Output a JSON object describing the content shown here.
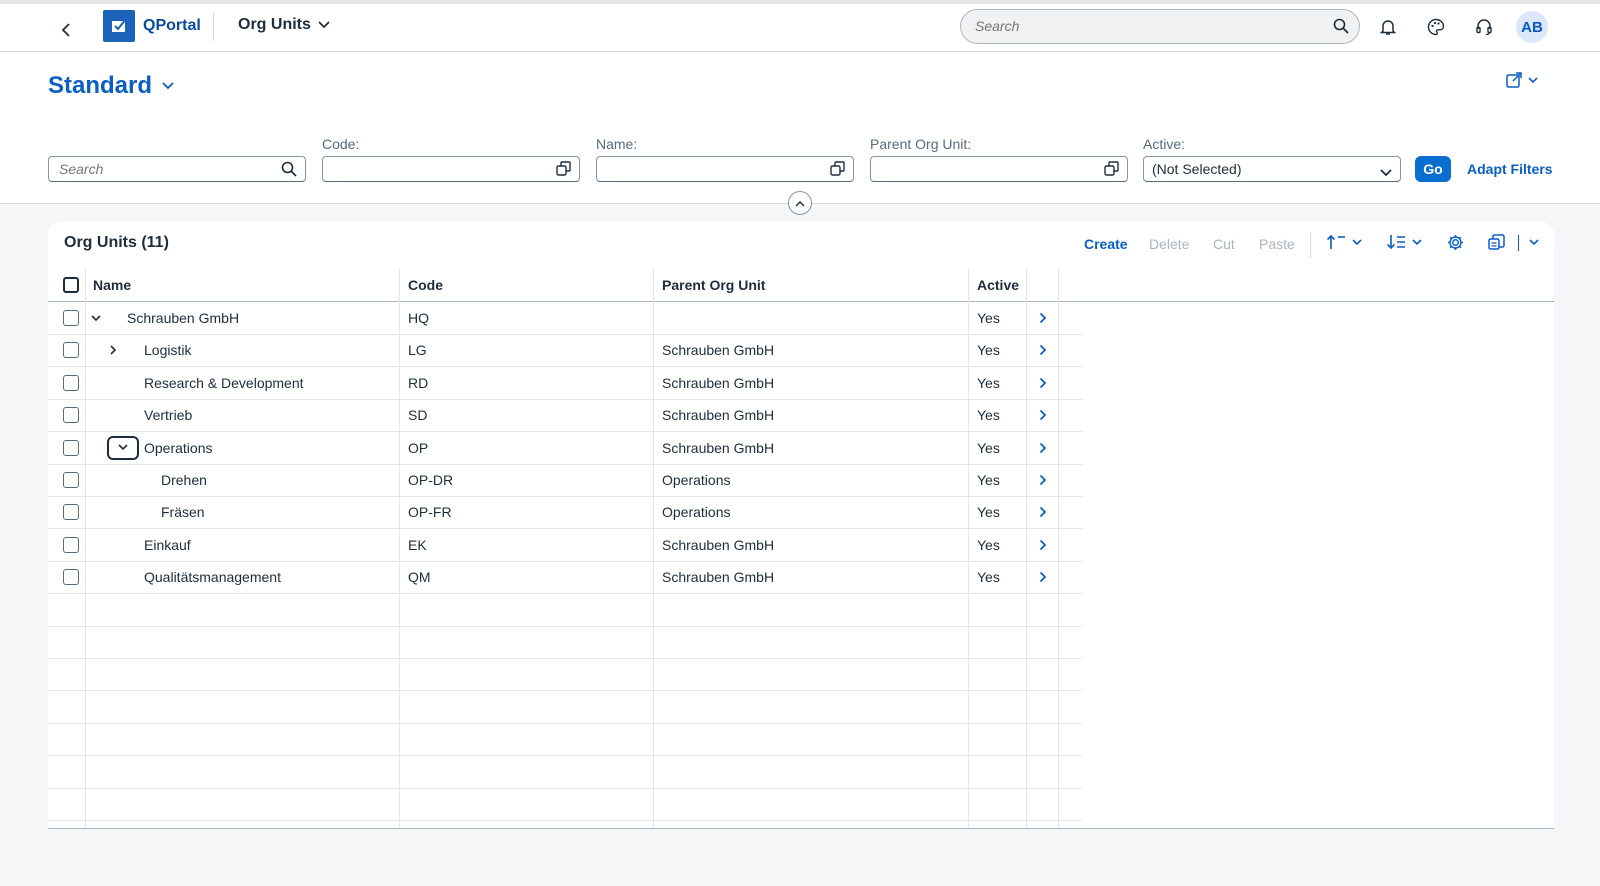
{
  "shell": {
    "brand": "QPortal",
    "app_title": "Org Units",
    "search_placeholder": "Search",
    "avatar_initials": "AB",
    "icons": [
      "back-icon",
      "notification-icon",
      "palette-icon",
      "headset-icon"
    ]
  },
  "header": {
    "variant_title": "Standard",
    "filters": {
      "search_placeholder": "Search",
      "code_label": "Code:",
      "name_label": "Name:",
      "parent_label": "Parent Org Unit:",
      "active_label": "Active:",
      "active_value": "(Not Selected)"
    },
    "go_label": "Go",
    "adapt_label": "Adapt Filters"
  },
  "table": {
    "title": "Org Units (11)",
    "toolbar": {
      "create": "Create",
      "delete": "Delete",
      "cut": "Cut",
      "paste": "Paste"
    },
    "columns": {
      "name": "Name",
      "code": "Code",
      "parent": "Parent Org Unit",
      "active": "Active"
    },
    "rows": [
      {
        "name": "Schrauben GmbH",
        "code": "HQ",
        "parent": "",
        "active": "Yes",
        "level": 0,
        "toggle": "expanded"
      },
      {
        "name": "Logistik",
        "code": "LG",
        "parent": "Schrauben GmbH",
        "active": "Yes",
        "level": 1,
        "toggle": "collapsed"
      },
      {
        "name": "Research & Development",
        "code": "RD",
        "parent": "Schrauben GmbH",
        "active": "Yes",
        "level": 1,
        "toggle": "none"
      },
      {
        "name": "Vertrieb",
        "code": "SD",
        "parent": "Schrauben GmbH",
        "active": "Yes",
        "level": 1,
        "toggle": "none"
      },
      {
        "name": "Operations",
        "code": "OP",
        "parent": "Schrauben GmbH",
        "active": "Yes",
        "level": 1,
        "toggle": "expanded-focused"
      },
      {
        "name": "Drehen",
        "code": "OP-DR",
        "parent": "Operations",
        "active": "Yes",
        "level": 2,
        "toggle": "none"
      },
      {
        "name": "Fräsen",
        "code": "OP-FR",
        "parent": "Operations",
        "active": "Yes",
        "level": 2,
        "toggle": "none"
      },
      {
        "name": "Einkauf",
        "code": "EK",
        "parent": "Schrauben GmbH",
        "active": "Yes",
        "level": 1,
        "toggle": "none"
      },
      {
        "name": "Qualitätsmanagement",
        "code": "QM",
        "parent": "Schrauben GmbH",
        "active": "Yes",
        "level": 1,
        "toggle": "none"
      }
    ],
    "empty_rows": 7
  }
}
